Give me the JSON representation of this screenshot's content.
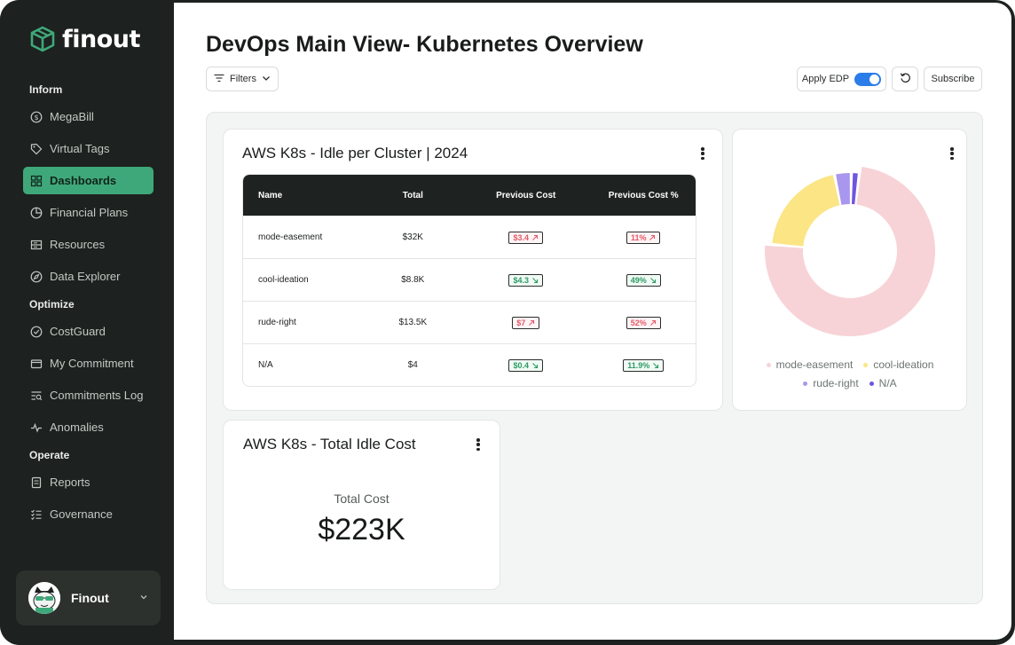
{
  "brand": {
    "name": "finout",
    "accent": "#3fa87a"
  },
  "sidebar": {
    "sections": [
      {
        "label": "Inform"
      },
      {
        "label": "Optimize"
      },
      {
        "label": "Operate"
      }
    ],
    "items": [
      {
        "label": "MegaBill",
        "icon": "dollar-circle-icon"
      },
      {
        "label": "Virtual Tags",
        "icon": "tag-icon"
      },
      {
        "label": "Dashboards",
        "icon": "grid-icon",
        "active": true
      },
      {
        "label": "Financial Plans",
        "icon": "pie-chart-icon"
      },
      {
        "label": "Resources",
        "icon": "server-icon"
      },
      {
        "label": "Data Explorer",
        "icon": "compass-icon"
      },
      {
        "label": "CostGuard",
        "icon": "shield-check-icon"
      },
      {
        "label": "My Commitment",
        "icon": "folder-icon"
      },
      {
        "label": "Commitments Log",
        "icon": "list-search-icon"
      },
      {
        "label": "Anomalies",
        "icon": "pulse-icon"
      },
      {
        "label": "Reports",
        "icon": "document-icon"
      },
      {
        "label": "Governance",
        "icon": "checklist-icon"
      }
    ],
    "profile": {
      "name": "Finout"
    }
  },
  "header": {
    "title": "DevOps Main View- Kubernetes Overview",
    "filters_label": "Filters",
    "apply_edp_label": "Apply EDP",
    "apply_edp_on": true,
    "subscribe_label": "Subscribe"
  },
  "idle_table": {
    "title": "AWS K8s - Idle per Cluster | 2024",
    "columns": [
      "Name",
      "Total",
      "Previous Cost",
      "Previous Cost %"
    ],
    "rows": [
      {
        "name": "mode-easement",
        "total": "$32K",
        "prev": "$3.4",
        "prev_pct": "11%",
        "trend": "up"
      },
      {
        "name": "cool-ideation",
        "total": "$8.8K",
        "prev": "$4.3",
        "prev_pct": "49%",
        "trend": "down"
      },
      {
        "name": "rude-right",
        "total": "$13.5K",
        "prev": "$7",
        "prev_pct": "52%",
        "trend": "up"
      },
      {
        "name": "N/A",
        "total": "$4",
        "prev": "$0.4",
        "prev_pct": "11.9%",
        "trend": "down"
      }
    ]
  },
  "chart_data": {
    "type": "pie",
    "donut": true,
    "categories": [
      "mode-easement",
      "cool-ideation",
      "rude-right",
      "N/A"
    ],
    "values": [
      32000,
      8800,
      1500,
      700
    ],
    "colors": [
      "#f7d3d7",
      "#fbe585",
      "#a996ee",
      "#6f55e0"
    ],
    "legend_position": "bottom"
  },
  "total_card": {
    "title": "AWS K8s - Total Idle Cost",
    "label": "Total Cost",
    "value": "$223K"
  }
}
